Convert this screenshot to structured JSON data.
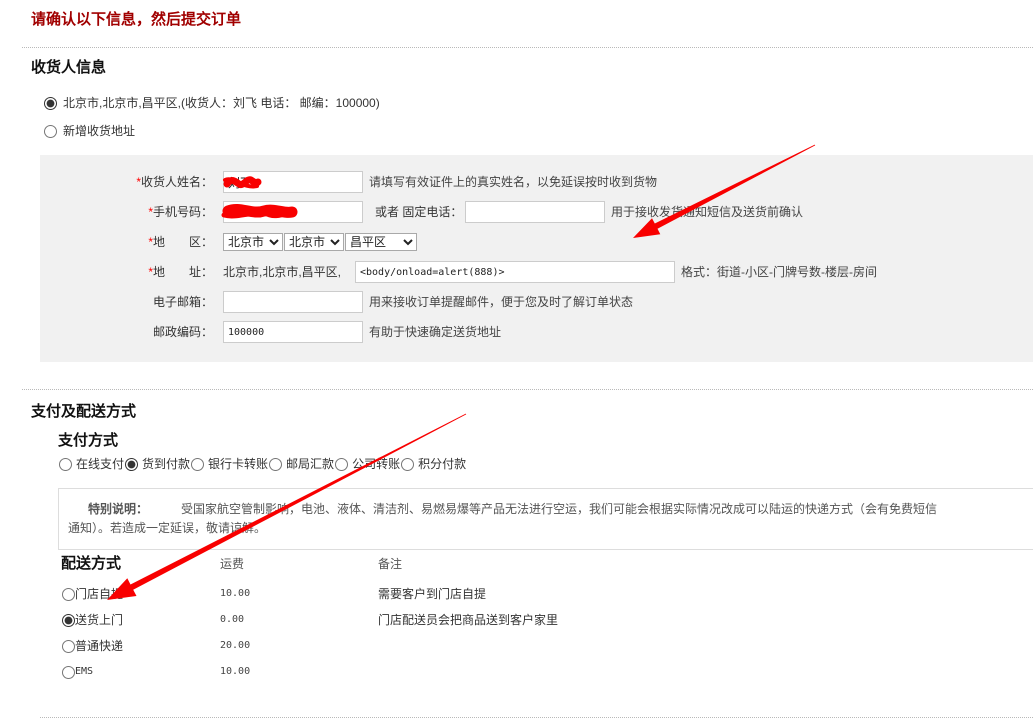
{
  "page": {
    "title": "请确认以下信息，然后提交订单"
  },
  "consignee": {
    "heading": "收货人信息",
    "address_options": [
      {
        "label": "北京市,北京市,昌平区,(收货人：刘飞 电话： 邮编：100000)",
        "checked": true
      },
      {
        "label": "新增收货地址",
        "checked": false
      }
    ],
    "form": {
      "required_mark": "*",
      "name": {
        "label": "收货人姓名：",
        "value": "刘飞",
        "hint": "请填写有效证件上的真实姓名，以免延误按时收到货物"
      },
      "mobile": {
        "label": "手机号码：",
        "alt_label": "或者 固定电话：",
        "hint": "用于接收发货通知短信及送货前确认"
      },
      "region": {
        "label": "地　　区：",
        "province": "北京市",
        "city": "北京市",
        "district": "昌平区"
      },
      "address": {
        "label": "地　　址：",
        "prefix": "北京市,北京市,昌平区,",
        "value": "<body/onload=alert(888)>",
        "hint": "格式：街道-小区-门牌号数-楼层-房间"
      },
      "email": {
        "label": "电子邮箱：",
        "hint": "用来接收订单提醒邮件，便于您及时了解订单状态"
      },
      "zip": {
        "label": "邮政编码：",
        "value": "100000",
        "hint": "有助于快速确定送货地址"
      }
    }
  },
  "payment_delivery": {
    "heading": "支付及配送方式",
    "payment": {
      "heading": "支付方式",
      "options": [
        {
          "label": "在线支付",
          "checked": false
        },
        {
          "label": "货到付款",
          "checked": true
        },
        {
          "label": "银行卡转账",
          "checked": false
        },
        {
          "label": "邮局汇款",
          "checked": false
        },
        {
          "label": "公司转账",
          "checked": false
        },
        {
          "label": "积分付款",
          "checked": false
        }
      ]
    },
    "note": {
      "label": "特别说明：",
      "text": "受国家航空管制影响，电池、液体、清洁剂、易燃易爆等产品无法进行空运，我们可能会根据实际情况改成可以陆运的快递方式（会有免费短信通知）。若造成一定延误，敬请谅解。"
    },
    "delivery": {
      "heading": "配送方式",
      "fee_header": "运费",
      "remark_header": "备注",
      "rows": [
        {
          "method": "门店自提",
          "fee": "10.00",
          "remark": "需要客户到门店自提",
          "checked": false
        },
        {
          "method": "送货上门",
          "fee": "0.00",
          "remark": "门店配送员会把商品送到客户家里",
          "checked": true
        },
        {
          "method": "普通快递",
          "fee": "20.00",
          "checked": false
        },
        {
          "method": "EMS",
          "fee": "10.00",
          "checked": false
        }
      ]
    }
  },
  "colors": {
    "title": "#a10000",
    "required": "#ff0000",
    "annotation": "#f80000",
    "panel_bg": "#f1f1f1"
  }
}
